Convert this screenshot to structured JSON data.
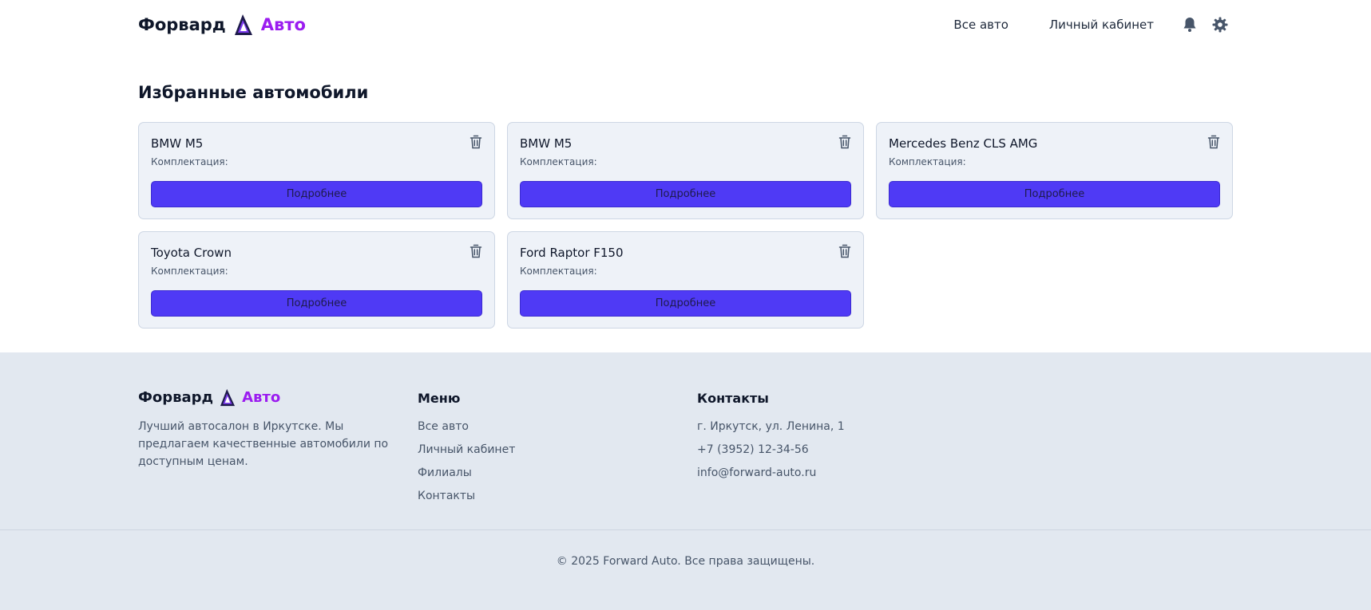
{
  "brand": {
    "name_part1": "Форвард",
    "name_part2": "Авто"
  },
  "nav": {
    "all_cars": "Все авто",
    "account": "Личный кабинет",
    "icons": [
      "bell-icon",
      "gear-icon"
    ]
  },
  "page": {
    "title": "Избранные автомобили"
  },
  "favorites": [
    {
      "name": "BMW M5",
      "trim_label": "Комплектация:",
      "button": "Подробнее"
    },
    {
      "name": "BMW M5",
      "trim_label": "Комплектация:",
      "button": "Подробнее"
    },
    {
      "name": "Mercedes Benz CLS AMG",
      "trim_label": "Комплектация:",
      "button": "Подробнее"
    },
    {
      "name": "Toyota Crown",
      "trim_label": "Комплектация:",
      "button": "Подробнее"
    },
    {
      "name": "Ford Raptor F150",
      "trim_label": "Комплектация:",
      "button": "Подробнее"
    }
  ],
  "footer": {
    "description": "Лучший автосалон в Иркутске. Мы предлагаем качественные автомобили по доступным ценам.",
    "menu_title": "Меню",
    "menu": [
      "Все авто",
      "Личный кабинет",
      "Филиалы",
      "Контакты"
    ],
    "contacts_title": "Контакты",
    "contacts": [
      "г. Иркутск, ул. Ленина, 1",
      "+7 (3952) 12-34-56",
      "info@forward-auto.ru"
    ],
    "copyright": "© 2025 Forward Auto. Все права защищены."
  },
  "colors": {
    "accent": "#4f3af5",
    "brand_purple": "#9b1cf0",
    "footer_bg": "#e2e8f0",
    "card_bg": "#eef2f8"
  }
}
